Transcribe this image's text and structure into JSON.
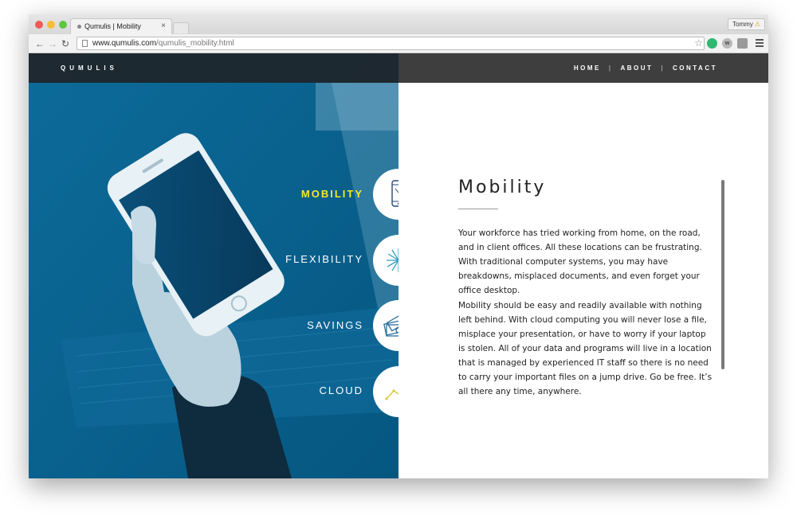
{
  "browser": {
    "tab_title": "Qumulis | Mobility",
    "tab_close": "×",
    "url_host": "www.qumulis.com",
    "url_path": "/qumulis_mobility.html",
    "profile_name": "Tommy",
    "profile_warning": "⚠",
    "back_glyph": "←",
    "forward_glyph": "→",
    "reload_glyph": "↻",
    "star_glyph": "☆",
    "ext_w_label": "w"
  },
  "site": {
    "logo": "QUMULIS",
    "nav": [
      "HOME",
      "ABOUT",
      "CONTACT"
    ],
    "nav_separator": "|"
  },
  "features": [
    {
      "label": "MOBILITY",
      "icon": "phone-icon",
      "active": true
    },
    {
      "label": "FLEXIBILITY",
      "icon": "starburst-icon",
      "active": false
    },
    {
      "label": "SAVINGS",
      "icon": "money-icon",
      "active": false
    },
    {
      "label": "CLOUD",
      "icon": "trend-line-icon",
      "active": false
    }
  ],
  "content": {
    "title": "Mobility",
    "paragraph_1": "Your workforce has tried working from home, on the road, and in client offices. All these locations can be frustrating. With traditional computer systems, you may have breakdowns, misplaced documents, and even forget your office desktop.",
    "paragraph_2": "Mobility should be easy and readily available with nothing left behind. With cloud computing you will never lose a file, misplace your presentation, or have to worry if your laptop is stolen. All of your data and programs will live in a location that is managed by experienced IT staff so there is no need to carry your important files on a jump drive. Go be free. It’s all there any time, anywhere."
  },
  "colors": {
    "hero_blue": "#085e8c",
    "accent_yellow": "#f3ea23",
    "icon_blue": "#3a9ec4",
    "icon_navy": "#2b4a7a"
  }
}
